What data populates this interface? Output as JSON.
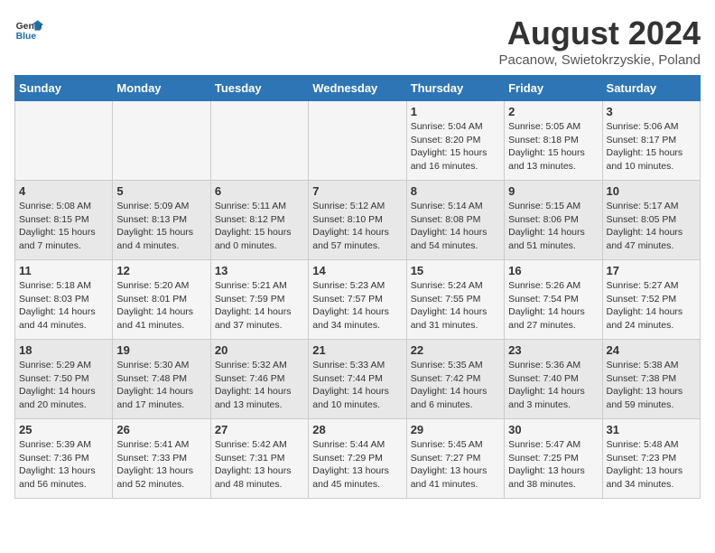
{
  "logo": {
    "general": "General",
    "blue": "Blue"
  },
  "title": "August 2024",
  "subtitle": "Pacanow, Swietokrzyskie, Poland",
  "weekdays": [
    "Sunday",
    "Monday",
    "Tuesday",
    "Wednesday",
    "Thursday",
    "Friday",
    "Saturday"
  ],
  "weeks": [
    [
      {
        "day": "",
        "text": ""
      },
      {
        "day": "",
        "text": ""
      },
      {
        "day": "",
        "text": ""
      },
      {
        "day": "",
        "text": ""
      },
      {
        "day": "1",
        "text": "Sunrise: 5:04 AM\nSunset: 8:20 PM\nDaylight: 15 hours and 16 minutes."
      },
      {
        "day": "2",
        "text": "Sunrise: 5:05 AM\nSunset: 8:18 PM\nDaylight: 15 hours and 13 minutes."
      },
      {
        "day": "3",
        "text": "Sunrise: 5:06 AM\nSunset: 8:17 PM\nDaylight: 15 hours and 10 minutes."
      }
    ],
    [
      {
        "day": "4",
        "text": "Sunrise: 5:08 AM\nSunset: 8:15 PM\nDaylight: 15 hours and 7 minutes."
      },
      {
        "day": "5",
        "text": "Sunrise: 5:09 AM\nSunset: 8:13 PM\nDaylight: 15 hours and 4 minutes."
      },
      {
        "day": "6",
        "text": "Sunrise: 5:11 AM\nSunset: 8:12 PM\nDaylight: 15 hours and 0 minutes."
      },
      {
        "day": "7",
        "text": "Sunrise: 5:12 AM\nSunset: 8:10 PM\nDaylight: 14 hours and 57 minutes."
      },
      {
        "day": "8",
        "text": "Sunrise: 5:14 AM\nSunset: 8:08 PM\nDaylight: 14 hours and 54 minutes."
      },
      {
        "day": "9",
        "text": "Sunrise: 5:15 AM\nSunset: 8:06 PM\nDaylight: 14 hours and 51 minutes."
      },
      {
        "day": "10",
        "text": "Sunrise: 5:17 AM\nSunset: 8:05 PM\nDaylight: 14 hours and 47 minutes."
      }
    ],
    [
      {
        "day": "11",
        "text": "Sunrise: 5:18 AM\nSunset: 8:03 PM\nDaylight: 14 hours and 44 minutes."
      },
      {
        "day": "12",
        "text": "Sunrise: 5:20 AM\nSunset: 8:01 PM\nDaylight: 14 hours and 41 minutes."
      },
      {
        "day": "13",
        "text": "Sunrise: 5:21 AM\nSunset: 7:59 PM\nDaylight: 14 hours and 37 minutes."
      },
      {
        "day": "14",
        "text": "Sunrise: 5:23 AM\nSunset: 7:57 PM\nDaylight: 14 hours and 34 minutes."
      },
      {
        "day": "15",
        "text": "Sunrise: 5:24 AM\nSunset: 7:55 PM\nDaylight: 14 hours and 31 minutes."
      },
      {
        "day": "16",
        "text": "Sunrise: 5:26 AM\nSunset: 7:54 PM\nDaylight: 14 hours and 27 minutes."
      },
      {
        "day": "17",
        "text": "Sunrise: 5:27 AM\nSunset: 7:52 PM\nDaylight: 14 hours and 24 minutes."
      }
    ],
    [
      {
        "day": "18",
        "text": "Sunrise: 5:29 AM\nSunset: 7:50 PM\nDaylight: 14 hours and 20 minutes."
      },
      {
        "day": "19",
        "text": "Sunrise: 5:30 AM\nSunset: 7:48 PM\nDaylight: 14 hours and 17 minutes."
      },
      {
        "day": "20",
        "text": "Sunrise: 5:32 AM\nSunset: 7:46 PM\nDaylight: 14 hours and 13 minutes."
      },
      {
        "day": "21",
        "text": "Sunrise: 5:33 AM\nSunset: 7:44 PM\nDaylight: 14 hours and 10 minutes."
      },
      {
        "day": "22",
        "text": "Sunrise: 5:35 AM\nSunset: 7:42 PM\nDaylight: 14 hours and 6 minutes."
      },
      {
        "day": "23",
        "text": "Sunrise: 5:36 AM\nSunset: 7:40 PM\nDaylight: 14 hours and 3 minutes."
      },
      {
        "day": "24",
        "text": "Sunrise: 5:38 AM\nSunset: 7:38 PM\nDaylight: 13 hours and 59 minutes."
      }
    ],
    [
      {
        "day": "25",
        "text": "Sunrise: 5:39 AM\nSunset: 7:36 PM\nDaylight: 13 hours and 56 minutes."
      },
      {
        "day": "26",
        "text": "Sunrise: 5:41 AM\nSunset: 7:33 PM\nDaylight: 13 hours and 52 minutes."
      },
      {
        "day": "27",
        "text": "Sunrise: 5:42 AM\nSunset: 7:31 PM\nDaylight: 13 hours and 48 minutes."
      },
      {
        "day": "28",
        "text": "Sunrise: 5:44 AM\nSunset: 7:29 PM\nDaylight: 13 hours and 45 minutes."
      },
      {
        "day": "29",
        "text": "Sunrise: 5:45 AM\nSunset: 7:27 PM\nDaylight: 13 hours and 41 minutes."
      },
      {
        "day": "30",
        "text": "Sunrise: 5:47 AM\nSunset: 7:25 PM\nDaylight: 13 hours and 38 minutes."
      },
      {
        "day": "31",
        "text": "Sunrise: 5:48 AM\nSunset: 7:23 PM\nDaylight: 13 hours and 34 minutes."
      }
    ]
  ]
}
